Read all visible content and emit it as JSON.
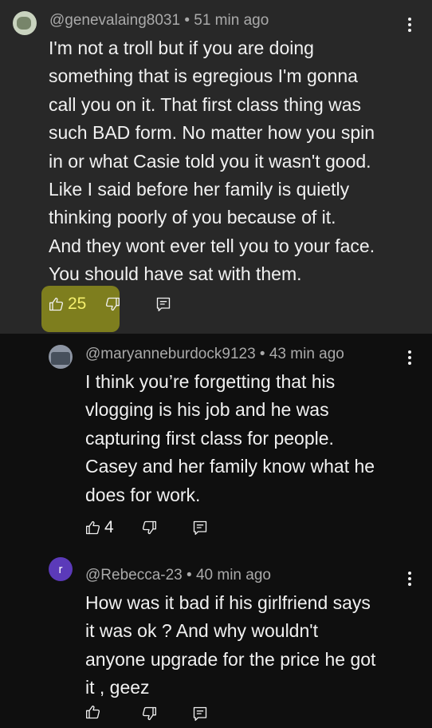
{
  "comments": [
    {
      "avatar_letter": "",
      "handle": "@genevalaing8031",
      "time": "51 min ago",
      "lines": [
        "I'm not a troll but if you are doing",
        "something that is egregious I'm gonna",
        "call you on it.  That first class thing was",
        "such BAD form.  No matter how you spin",
        "in or what Casie told you it wasn't good.",
        "Like I said before her family is quietly",
        "thinking poorly of you because of it.",
        "And they wont ever tell you to your face.",
        "You should have sat with them."
      ],
      "likes": "25"
    },
    {
      "avatar_letter": "",
      "handle": "@maryanneburdock9123",
      "time": "43 min ago",
      "lines": [
        "I think you’re forgetting that his",
        "vlogging is his job and he was",
        "capturing first class for people.",
        "Casey and her family know what he",
        "does for work."
      ],
      "likes": "4"
    },
    {
      "avatar_letter": "r",
      "handle": "@Rebecca-23",
      "time": "40 min ago",
      "lines": [
        "How was it bad if his girlfriend says",
        "it was ok ? And why wouldn't",
        "anyone upgrade for the price he got",
        "it , geez"
      ],
      "likes": ""
    }
  ],
  "separator": "•",
  "icons": {
    "like": "thumbs-up-icon",
    "dislike": "thumbs-down-icon",
    "reply": "reply-comment-icon",
    "more": "more-vertical-icon"
  },
  "colors": {
    "highlighted_background": "#282828",
    "background": "#0f0f0f",
    "highlight": "#c4c416",
    "avatar_rebecca": "#5b3ab9"
  }
}
